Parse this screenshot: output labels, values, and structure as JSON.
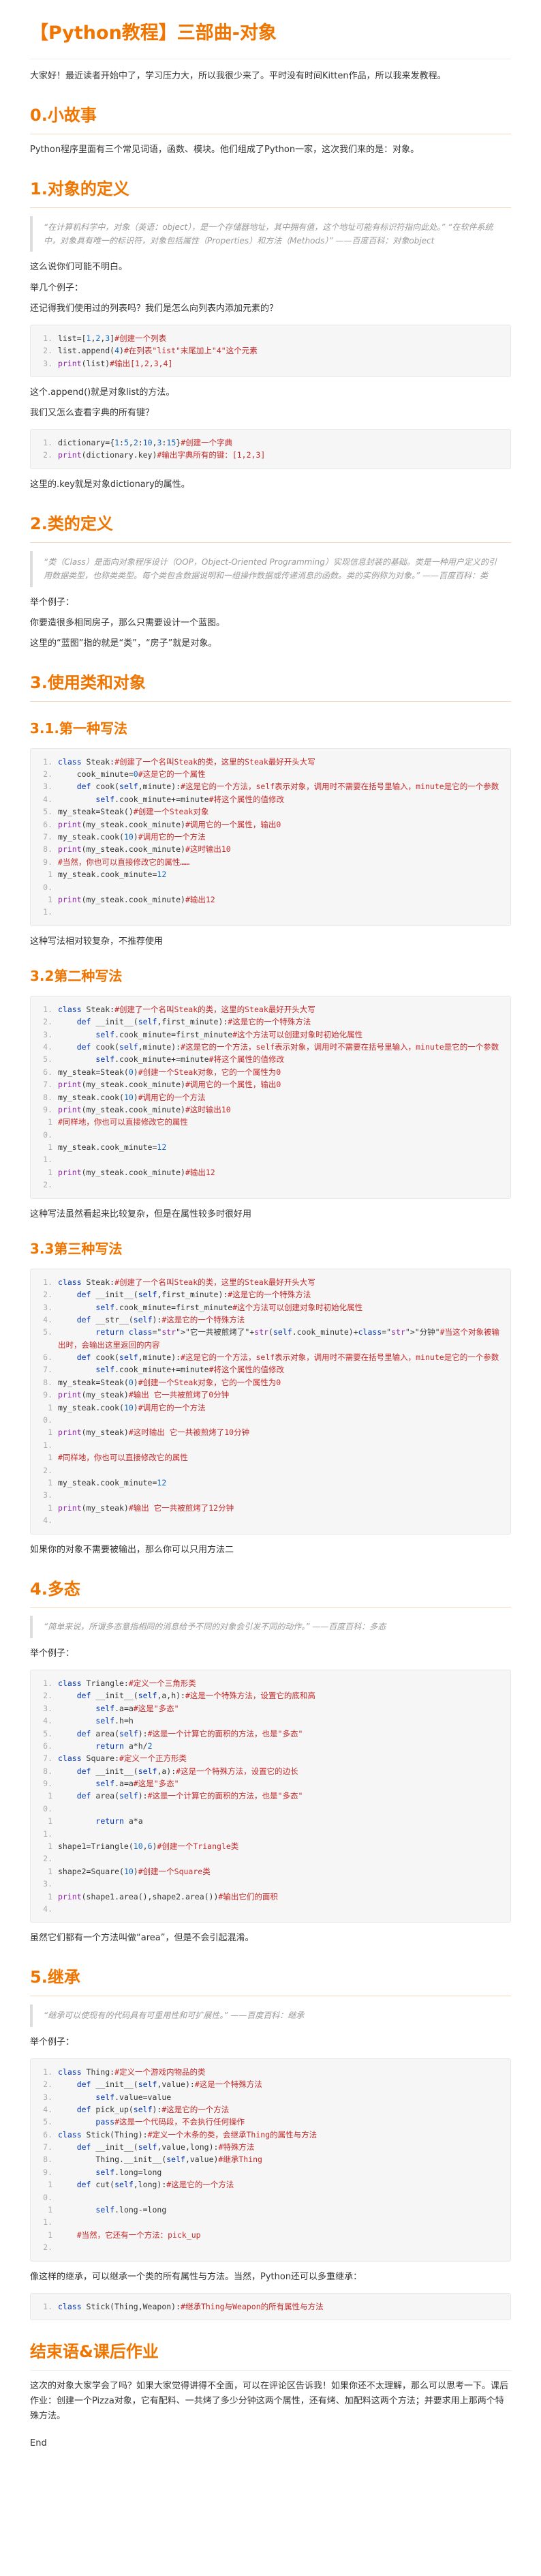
{
  "title": "【Python教程】三部曲-对象",
  "intro": "大家好！最近读者开始中了，学习压力大，所以我很少来了。平时没有时间Kitten作品，所以我来发教程。",
  "sections": {
    "s0": {
      "heading": "0.小故事",
      "text": "Python程序里面有三个常见词语，函数、模块。他们组成了Python一家，这次我们来的是：对象。"
    },
    "s1": {
      "heading": "1.对象的定义",
      "quote": "“在计算机科学中，对象（英语：object），是一个存储器地址，其中拥有值，这个地址可能有标识符指向此处。” “在软件系统中，对象具有唯一的标识符，对象包括属性（Properties）和方法（Methods）” ——百度百科：对象object",
      "p1": "这么说你们可能不明白。",
      "p2": "举几个例子：",
      "p3": "还记得我们使用过的列表吗？我们是怎么向列表内添加元素的？",
      "code1": [
        "list=[1,2,3]#创建一个列表",
        "list.append(4)#在列表\"list\"末尾加上\"4\"这个元素",
        "print(list)#输出[1,2,3,4]"
      ],
      "p4": "这个.append()就是对象list的方法。",
      "p5": "我们又怎么查看字典的所有键？",
      "code2": [
        "dictionary={1:5,2:10,3:15}#创建一个字典",
        "print(dictionary.key)#输出字典所有的键：[1,2,3]"
      ],
      "p6": "这里的.key就是对象dictionary的属性。"
    },
    "s2": {
      "heading": "2.类的定义",
      "quote": "“类（Class）是面向对象程序设计（OOP，Object-Oriented Programming）实现信息封装的基础。类是一种用户定义的引用数据类型，也称类类型。每个类包含数据说明和一组操作数据或传递消息的函数。类的实例称为对象。” ——百度百科：类",
      "p1": "举个例子：",
      "p2": "你要造很多相同房子，那么只需要设计一个蓝图。",
      "p3": "这里的“蓝图”指的就是“类”，“房子”就是对象。"
    },
    "s3": {
      "heading": "3.使用类和对象",
      "sub1": {
        "heading": "3.1.第一种写法",
        "code": [
          "class Steak:#创建了一个名叫Steak的类，这里的Steak最好开头大写",
          "    cook_minute=0#这是它的一个属性",
          "    def cook(self,minute):#这是它的一个方法，self表示对象，调用时不需要在括号里输入，minute是它的一个参数",
          "        self.cook_minute+=minute#将这个属性的值修改",
          "my_steak=Steak()#创建一个Steak对象",
          "print(my_steak.cook_minute)#调用它的一个属性，输出0",
          "my_steak.cook(10)#调用它的一个方法",
          "print(my_steak.cook_minute)#这时输出10",
          "#当然，你也可以直接修改它的属性……",
          "my_steak.cook_minute=12",
          "print(my_steak.cook_minute)#输出12"
        ],
        "after": "这种写法相对较复杂，不推荐使用"
      },
      "sub2": {
        "heading": "3.2第二种写法",
        "code": [
          "class Steak:#创建了一个名叫Steak的类，这里的Steak最好开头大写",
          "    def __init__(self,first_minute):#这是它的一个特殊方法",
          "        self.cook_minute=first_minute#这个方法可以创建对象时初始化属性",
          "    def cook(self,minute):#这是它的一个方法，self表示对象，调用时不需要在括号里输入，minute是它的一个参数",
          "        self.cook_minute+=minute#将这个属性的值修改",
          "my_steak=Steak(0)#创建一个Steak对象，它的一个属性为0",
          "print(my_steak.cook_minute)#调用它的一个属性，输出0",
          "my_steak.cook(10)#调用它的一个方法",
          "print(my_steak.cook_minute)#这时输出10",
          "#同样地，你也可以直接修改它的属性",
          "my_steak.cook_minute=12",
          "print(my_steak.cook_minute)#输出12"
        ],
        "after": "这种写法虽然看起来比较复杂，但是在属性较多时很好用"
      },
      "sub3": {
        "heading": "3.3第三种写法",
        "code": [
          "class Steak:#创建了一个名叫Steak的类，这里的Steak最好开头大写",
          "    def __init__(self,first_minute):#这是它的一个特殊方法",
          "        self.cook_minute=first_minute#这个方法可以创建对象时初始化属性",
          "    def __str__(self):#这是它的一个特殊方法",
          "        return \"它一共被煎烤了\"+str(self.cook_minute)+\"分钟\"#当这个对象被输出时，会输出这里返回的内容",
          "    def cook(self,minute):#这是它的一个方法，self表示对象，调用时不需要在括号里输入，minute是它的一个参数",
          "        self.cook_minute+=minute#将这个属性的值修改",
          "my_steak=Steak(0)#创建一个Steak对象，它的一个属性为0",
          "print(my_steak)#输出 它一共被煎烤了0分钟",
          "my_steak.cook(10)#调用它的一个方法",
          "print(my_steak)#这时输出 它一共被煎烤了10分钟",
          "#同样地，你也可以直接修改它的属性",
          "my_steak.cook_minute=12",
          "print(my_steak)#输出 它一共被煎烤了12分钟"
        ],
        "after": "如果你的对象不需要被输出，那么你可以只用方法二"
      }
    },
    "s4": {
      "heading": "4.多态",
      "quote": "“简单来说，所谓多态意指相同的消息给予不同的对象会引发不同的动作。” ——百度百科：多态",
      "p1": "举个例子：",
      "code": [
        "class Triangle:#定义一个三角形类",
        "    def __init__(self,a,h):#这是一个特殊方法，设置它的底和高",
        "        self.a=a#这是\"多态\"",
        "        self.h=h",
        "    def area(self):#这是一个计算它的面积的方法，也是\"多态\"",
        "        return a*h/2",
        "class Square:#定义一个正方形类",
        "    def __init__(self,a):#这是一个特殊方法，设置它的边长",
        "        self.a=a#这是\"多态\"",
        "    def area(self):#这是一个计算它的面积的方法，也是\"多态\"",
        "        return a*a",
        "shape1=Triangle(10,6)#创建一个Triangle类",
        "shape2=Square(10)#创建一个Square类",
        "print(shape1.area(),shape2.area())#输出它们的面积"
      ],
      "after": "虽然它们都有一个方法叫做“area”，但是不会引起混淆。"
    },
    "s5": {
      "heading": "5.继承",
      "quote": "“继承可以使现有的代码具有可重用性和可扩展性。” ——百度百科：继承",
      "p1": "举个例子：",
      "code": [
        "class Thing:#定义一个游戏内物品的类",
        "    def __init__(self,value):#这是一个特殊方法",
        "        self.value=value",
        "    def pick_up(self):#这是它的一个方法",
        "        pass#这是一个代码段，不会执行任何操作",
        "class Stick(Thing):#定义一个木条的类，会继承Thing的属性与方法",
        "    def __init__(self,value,long):#特殊方法",
        "        Thing.__init__(self,value)#继承Thing",
        "        self.long=long",
        "    def cut(self,long):#这是它的一个方法",
        "        self.long-=long",
        "    #当然，它还有一个方法：pick_up"
      ],
      "after": "像这样的继承，可以继承一个类的所有属性与方法。当然，Python还可以多重继承：",
      "code2": [
        "class Stick(Thing,Weapon):#继承Thing与Weapon的所有属性与方法"
      ]
    },
    "end": {
      "heading": "结束语&课后作业",
      "text": "这次的对象大家学会了吗？如果大家觉得讲得不全面，可以在评论区告诉我！如果你还不太理解，那么可以思考一下。课后作业：创建一个Pizza对象，它有配料、一共烤了多少分钟这两个属性，还有烤、加配料这两个方法；并要求用上那两个特殊方法。",
      "last": "End"
    }
  },
  "colors": {
    "heading": "#ef7500",
    "keyword": "#0033b3",
    "comment": "#c62828"
  }
}
